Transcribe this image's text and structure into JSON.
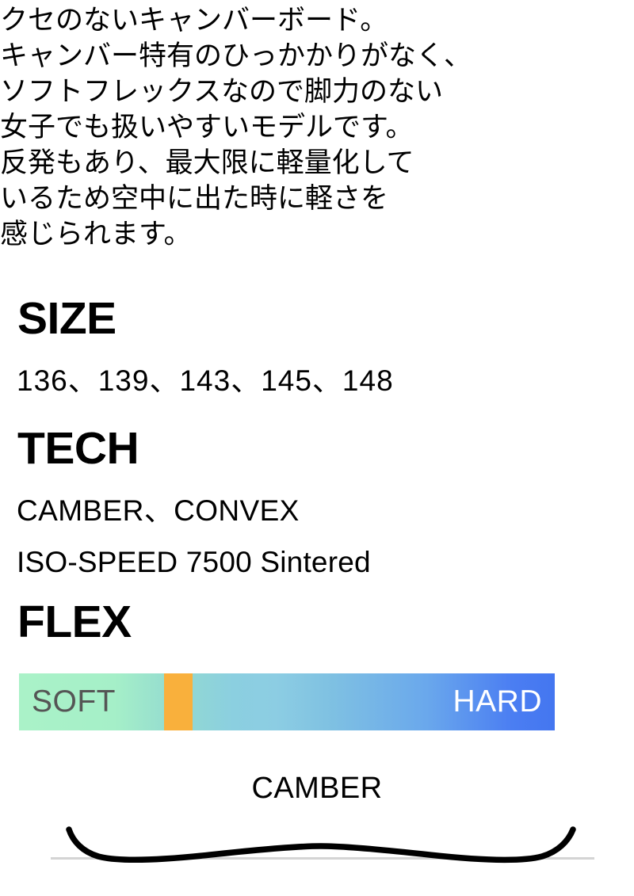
{
  "description": {
    "lines": [
      "クセのないキャンバーボード。",
      "キャンバー特有のひっかかりがなく、",
      "ソフトフレックスなので脚力のない",
      "女子でも扱いやすいモデルです。",
      "反発もあり、最大限に軽量化して",
      "いるため空中に出た時に軽さを",
      "感じられます。"
    ]
  },
  "sections": {
    "size": {
      "heading": "SIZE",
      "values": "136、139、143、145、148"
    },
    "tech": {
      "heading": "TECH",
      "line1": "CAMBER、CONVEX",
      "line2": "ISO-SPEED 7500 Sintered"
    },
    "flex": {
      "heading": "FLEX",
      "soft_label": "SOFT",
      "hard_label": "HARD",
      "marker_position_percent": 28,
      "gradient_start_color": "#aaf2c8",
      "gradient_end_color": "#4476f0",
      "marker_color": "#f9b03c",
      "soft_label_color": "#555555",
      "hard_label_color": "#ffffff"
    }
  },
  "camber": {
    "title": "CAMBER",
    "profile_color": "#000000",
    "ground_line_color": "#d4d4d4"
  }
}
